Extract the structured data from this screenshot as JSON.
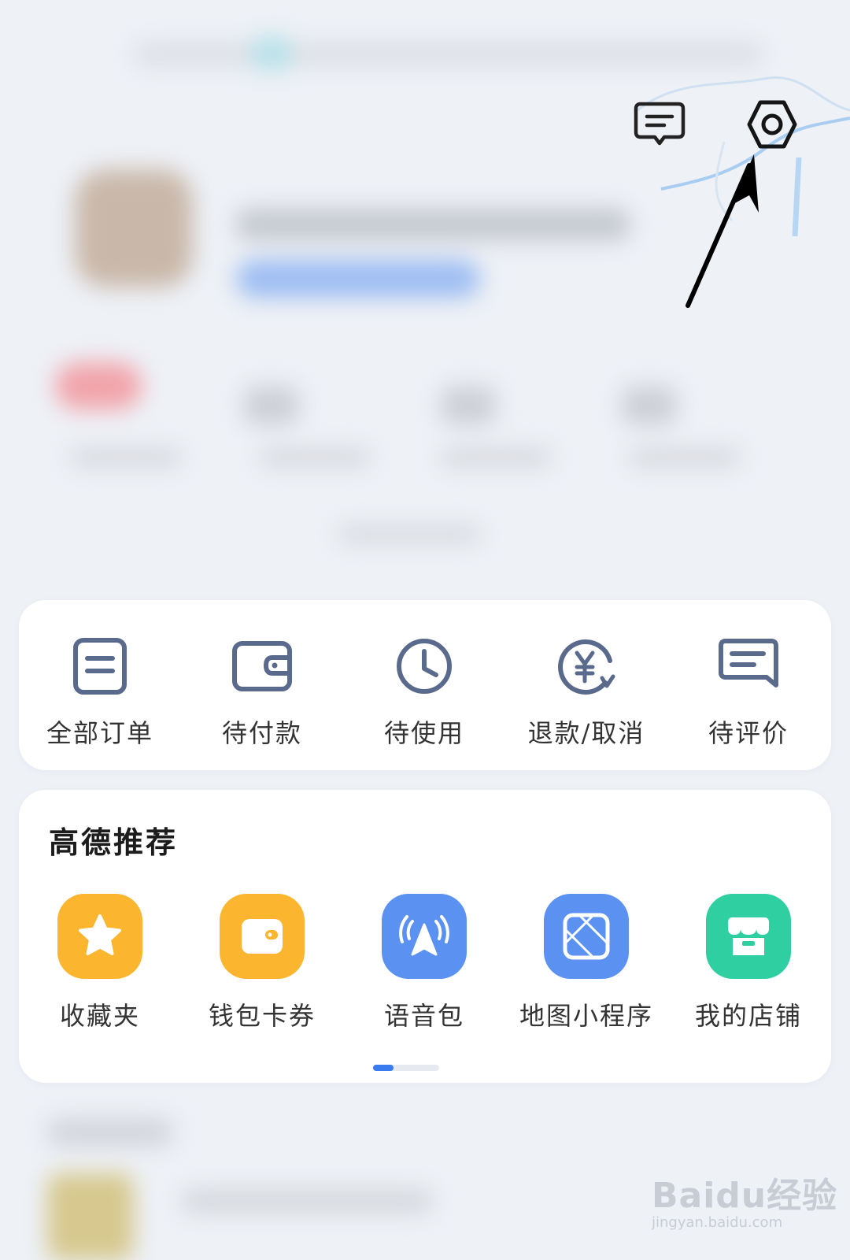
{
  "header": {
    "message_icon": "message-icon",
    "settings_icon": "settings-icon",
    "annotation": "arrow-pointing-to-settings"
  },
  "orders": {
    "items": [
      {
        "label": "全部订单",
        "icon": "order-list-icon"
      },
      {
        "label": "待付款",
        "icon": "wallet-icon"
      },
      {
        "label": "待使用",
        "icon": "clock-icon"
      },
      {
        "label": "退款/取消",
        "icon": "refund-yen-icon"
      },
      {
        "label": "待评价",
        "icon": "review-icon"
      }
    ]
  },
  "recommend": {
    "title": "高德推荐",
    "items": [
      {
        "label": "收藏夹",
        "icon": "star-icon",
        "color": "#fbb52e"
      },
      {
        "label": "钱包卡券",
        "icon": "wallet-icon",
        "color": "#fbb52e"
      },
      {
        "label": "语音包",
        "icon": "voice-nav-icon",
        "color": "#5b92f2"
      },
      {
        "label": "地图小程序",
        "icon": "map-mini-program-icon",
        "color": "#5b92f2"
      },
      {
        "label": "我的店铺",
        "icon": "store-icon",
        "color": "#2fcfa2"
      }
    ],
    "page_indicator": {
      "pages": 2,
      "current": 1
    }
  },
  "watermark": {
    "logo": "Baidu经验",
    "url": "jingyan.baidu.com"
  },
  "colors": {
    "icon_stroke": "#5a6a8c",
    "accent": "#3a7cf0",
    "background": "#eef1f6"
  }
}
